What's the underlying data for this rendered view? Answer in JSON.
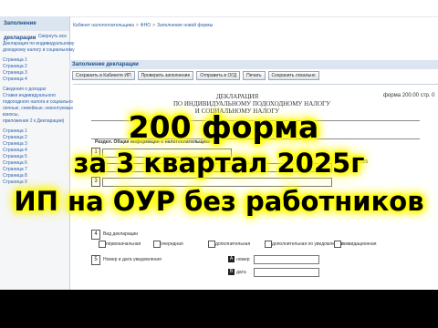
{
  "sidebar": {
    "title": "Заполнение декларации",
    "collapse_label": "Свернуть все",
    "items": [
      "Декларация по индивидуальному",
      "доходному налогу и социальному",
      "Страница 1",
      "Страница 2",
      "Страница 3",
      "Страница 4",
      "Сведения о доходах",
      "Ставки индивидуального",
      "подоходного налога и социального налога,",
      "личные, семейные, неконтуемые",
      "взносы,",
      "приложения 2 к Декларации)",
      "Страница 1",
      "Страница 2",
      "Страница 3",
      "Страница 4",
      "Страница 5",
      "Страница 6",
      "Страница 7",
      "Страница 8",
      "Страница 9"
    ]
  },
  "breadcrumb": {
    "items": [
      "Кабинет налогоплательщика",
      "ФНО",
      "Заполнение новой формы"
    ]
  },
  "panel_title": "Заполнение декларации",
  "toolbar": {
    "buttons": [
      "Сохранить в Кабинете ИП",
      "Проверить заполнение",
      "Отправить в ОГД",
      "Печать",
      "Сохранить локально"
    ]
  },
  "form": {
    "title_line1": "ДЕКЛАРАЦИЯ",
    "title_line2": "ПО ИНДИВИДУАЛЬНОМУ ПОДОХОДНОМУ НАЛОГУ",
    "title_line3": "И СОЦИАЛЬНОМУ НАЛОГУ",
    "form_code": "форма 200.00  стр. 0",
    "section_label": "Раздел. Общая информация о налогоплательщике",
    "field_4_label": "Вид декларации",
    "field_4_opts": [
      "первоначальная",
      "очередная",
      "дополнительная",
      "дополнительная по уведомлению",
      "ликвидационная"
    ],
    "field_5_label": "Номер и дата уведомления",
    "field_5_a": "номер",
    "field_5_b": "дата",
    "year_value": "2025"
  },
  "overlay": {
    "line1": "200 форма",
    "line2": "за 3 квартал 2025г",
    "line3": "ИП на ОУР без работников"
  },
  "colors": {
    "overlay_glow": "#ffff00",
    "link": "#2b5fa8",
    "panel_header": "#dce6f1"
  }
}
